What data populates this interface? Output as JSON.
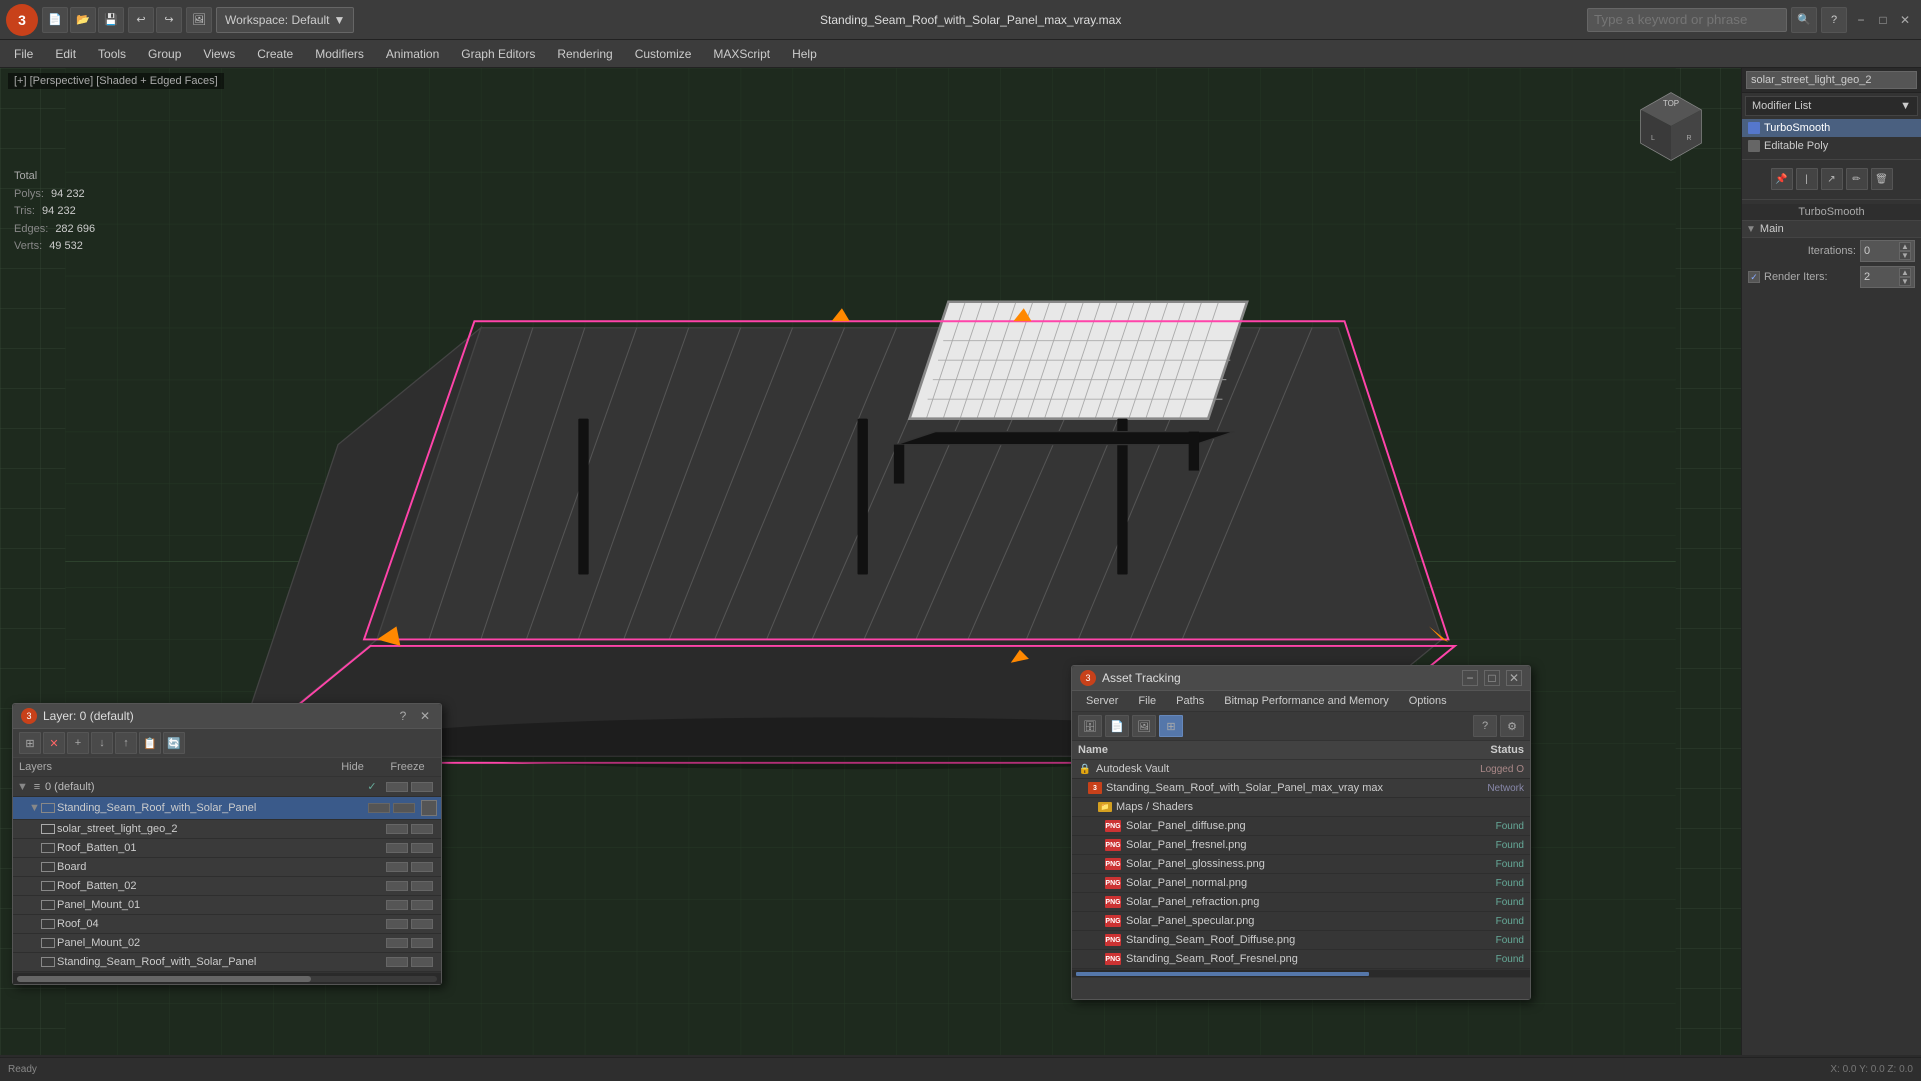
{
  "app": {
    "logo": "3",
    "title": "Standing_Seam_Roof_with_Solar_Panel_max_vray.max",
    "workspace_label": "Workspace: Default"
  },
  "toolbar": {
    "undo": "↩",
    "redo": "↪",
    "open": "📂",
    "save": "💾",
    "new": "📄",
    "render_frame": "🖼",
    "workspace_dropdown": "▼"
  },
  "search": {
    "placeholder": "Type a keyword or phrase"
  },
  "window_controls": {
    "minimize": "−",
    "maximize": "□",
    "close": "✕"
  },
  "menu": {
    "items": [
      "File",
      "Edit",
      "Tools",
      "Group",
      "Views",
      "Create",
      "Modifiers",
      "Animation",
      "Graph Editors",
      "Rendering",
      "Customize",
      "MAXScript",
      "Help"
    ]
  },
  "viewport": {
    "label": "[+] [Perspective] [Shaded + Edged Faces]"
  },
  "stats": {
    "total_label": "Total",
    "polys_label": "Polys:",
    "polys_value": "94 232",
    "tris_label": "Tris:",
    "tris_value": "94 232",
    "edges_label": "Edges:",
    "edges_value": "282 696",
    "verts_label": "Verts:",
    "verts_value": "49 532"
  },
  "right_panel": {
    "object_name": "solar_street_light_geo_2",
    "modifier_list_label": "Modifier List",
    "modifiers": [
      {
        "name": "TurboSmooth",
        "active": true
      },
      {
        "name": "Editable Poly",
        "active": false
      }
    ],
    "section_title": "TurboSmooth",
    "main_label": "Main",
    "iterations_label": "Iterations:",
    "iterations_value": "0",
    "render_iters_label": "Render Iters:",
    "render_iters_value": "2",
    "render_iters_checkbox": true
  },
  "layer_panel": {
    "title": "Layer: 0 (default)",
    "toolbar_icons": [
      "⊞",
      "✕",
      "+",
      "↓",
      "↑",
      "📋",
      "🔄"
    ],
    "header": {
      "layers": "Layers",
      "hide": "Hide",
      "freeze": "Freeze"
    },
    "layers": [
      {
        "indent": 0,
        "name": "0 (default)",
        "is_default": true,
        "active": true,
        "check": true
      },
      {
        "indent": 1,
        "name": "Standing_Seam_Roof_with_Solar_Panel",
        "is_default": false,
        "active": true,
        "selected": true
      },
      {
        "indent": 2,
        "name": "solar_street_light_geo_2",
        "is_default": false,
        "active": false
      },
      {
        "indent": 2,
        "name": "Roof_Batten_01",
        "is_default": false,
        "active": false
      },
      {
        "indent": 2,
        "name": "Board",
        "is_default": false,
        "active": false
      },
      {
        "indent": 2,
        "name": "Roof_Batten_02",
        "is_default": false,
        "active": false
      },
      {
        "indent": 2,
        "name": "Panel_Mount_01",
        "is_default": false,
        "active": false
      },
      {
        "indent": 2,
        "name": "Roof_04",
        "is_default": false,
        "active": false
      },
      {
        "indent": 2,
        "name": "Panel_Mount_02",
        "is_default": false,
        "active": false
      },
      {
        "indent": 2,
        "name": "Standing_Seam_Roof_with_Solar_Panel",
        "is_default": false,
        "active": false
      }
    ]
  },
  "asset_tracking": {
    "title": "Asset Tracking",
    "menu_items": [
      "Server",
      "File",
      "Paths",
      "Bitmap Performance and Memory",
      "Options"
    ],
    "toolbar_icons": [
      "🗄",
      "📄",
      "🖼",
      "⊞"
    ],
    "table_header": {
      "name": "Name",
      "status": "Status"
    },
    "items": [
      {
        "level": 0,
        "name": "Autodesk Vault",
        "status": "Logged O",
        "icon_type": "vault"
      },
      {
        "level": 1,
        "name": "Standing_Seam_Roof_with_Solar_Panel_max_vray max",
        "status": "Network",
        "icon_type": "file"
      },
      {
        "level": 2,
        "name": "Maps / Shaders",
        "status": "",
        "icon_type": "folder"
      },
      {
        "level": 3,
        "name": "Solar_Panel_diffuse.png",
        "status": "Found",
        "icon_type": "png"
      },
      {
        "level": 3,
        "name": "Solar_Panel_fresnel.png",
        "status": "Found",
        "icon_type": "png"
      },
      {
        "level": 3,
        "name": "Solar_Panel_glossiness.png",
        "status": "Found",
        "icon_type": "png"
      },
      {
        "level": 3,
        "name": "Solar_Panel_normal.png",
        "status": "Found",
        "icon_type": "png"
      },
      {
        "level": 3,
        "name": "Solar_Panel_refraction.png",
        "status": "Found",
        "icon_type": "png"
      },
      {
        "level": 3,
        "name": "Solar_Panel_specular.png",
        "status": "Found",
        "icon_type": "png"
      },
      {
        "level": 3,
        "name": "Standing_Seam_Roof_Diffuse.png",
        "status": "Found",
        "icon_type": "png"
      },
      {
        "level": 3,
        "name": "Standing_Seam_Roof_Fresnel.png",
        "status": "Found",
        "icon_type": "png"
      }
    ]
  }
}
